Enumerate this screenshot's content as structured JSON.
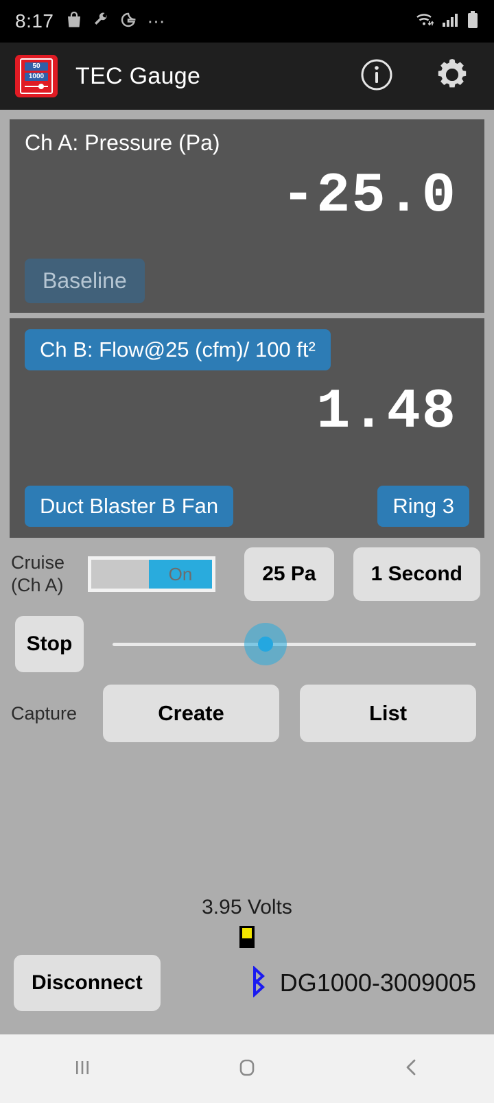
{
  "status_bar": {
    "time": "8:17",
    "left_icons": [
      "shopping-bag-icon",
      "wrench-icon",
      "google-g-icon",
      "overflow-dots-icon"
    ],
    "right_icons": [
      "wifi-icon",
      "cellular-signal-icon",
      "battery-icon"
    ]
  },
  "app_bar": {
    "title": "TEC Gauge",
    "icon": {
      "name": "tec-gauge-app-icon",
      "top_value": "50",
      "bottom_value": "1000",
      "color": "#e01b24"
    },
    "actions": [
      {
        "name": "info-icon",
        "label": "Info"
      },
      {
        "name": "gear-icon",
        "label": "Settings"
      }
    ]
  },
  "channel_a": {
    "label": "Ch A: Pressure (Pa)",
    "value": "-25.0",
    "baseline_label": "Baseline",
    "baseline_color": "#41617a",
    "panel_color": "#555555"
  },
  "channel_b": {
    "label": "Ch B: Flow@25 (cfm)/ 100 ft²",
    "value": "1.48",
    "fan_label": "Duct Blaster B Fan",
    "ring_label": "Ring 3",
    "button_color": "#2d7cb5"
  },
  "controls": {
    "cruise_label_line1": "Cruise",
    "cruise_label_line2": "(Ch A)",
    "cruise_toggle_state": "On",
    "cruise_toggle_color": "#29abdd",
    "target_pressure": "25 Pa",
    "interval": "1 Second",
    "stop_label": "Stop",
    "slider_position_percent": 42,
    "capture_label": "Capture",
    "create_label": "Create",
    "list_label": "List"
  },
  "footer": {
    "voltage": "3.95 Volts",
    "battery_icon": "device-battery-icon",
    "battery_fill_color": "#f2e500",
    "disconnect_label": "Disconnect",
    "bluetooth_icon": "bluetooth-icon",
    "bluetooth_color": "#1a1af0",
    "device_name": "DG1000-3009005"
  },
  "nav_bar": {
    "recents": "recents-icon",
    "home": "home-icon",
    "back": "back-icon"
  }
}
